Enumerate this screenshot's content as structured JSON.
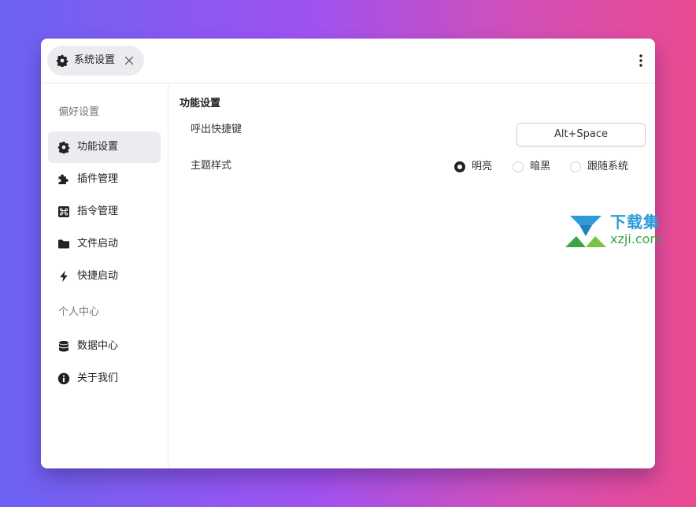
{
  "tab": {
    "label": "系统设置",
    "icon": "gear-icon",
    "close_icon": "close-icon"
  },
  "header": {
    "menu_icon": "more-vertical-icon"
  },
  "sidebar": {
    "section1": "偏好设置",
    "section2": "个人中心",
    "items": [
      {
        "label": "功能设置",
        "icon": "gear-icon",
        "active": true
      },
      {
        "label": "插件管理",
        "icon": "puzzle-icon"
      },
      {
        "label": "指令管理",
        "icon": "command-icon"
      },
      {
        "label": "文件启动",
        "icon": "folder-icon"
      },
      {
        "label": "快捷启动",
        "icon": "lightning-icon"
      },
      {
        "label": "数据中心",
        "icon": "database-icon"
      },
      {
        "label": "关于我们",
        "icon": "info-icon"
      }
    ]
  },
  "main": {
    "title": "功能设置",
    "hotkey": {
      "label": "呼出快捷键",
      "value": "Alt+Space"
    },
    "theme": {
      "label": "主题样式",
      "options": [
        "明亮",
        "暗黑",
        "跟随系统"
      ],
      "selected": "明亮"
    }
  },
  "watermark": {
    "cn": "下载集",
    "url": "xzji.com"
  },
  "colors": {
    "accent": "#222222",
    "active_bg": "#ececf0",
    "watermark_blue": "#2e9ad8",
    "watermark_green": "#3aa344"
  }
}
